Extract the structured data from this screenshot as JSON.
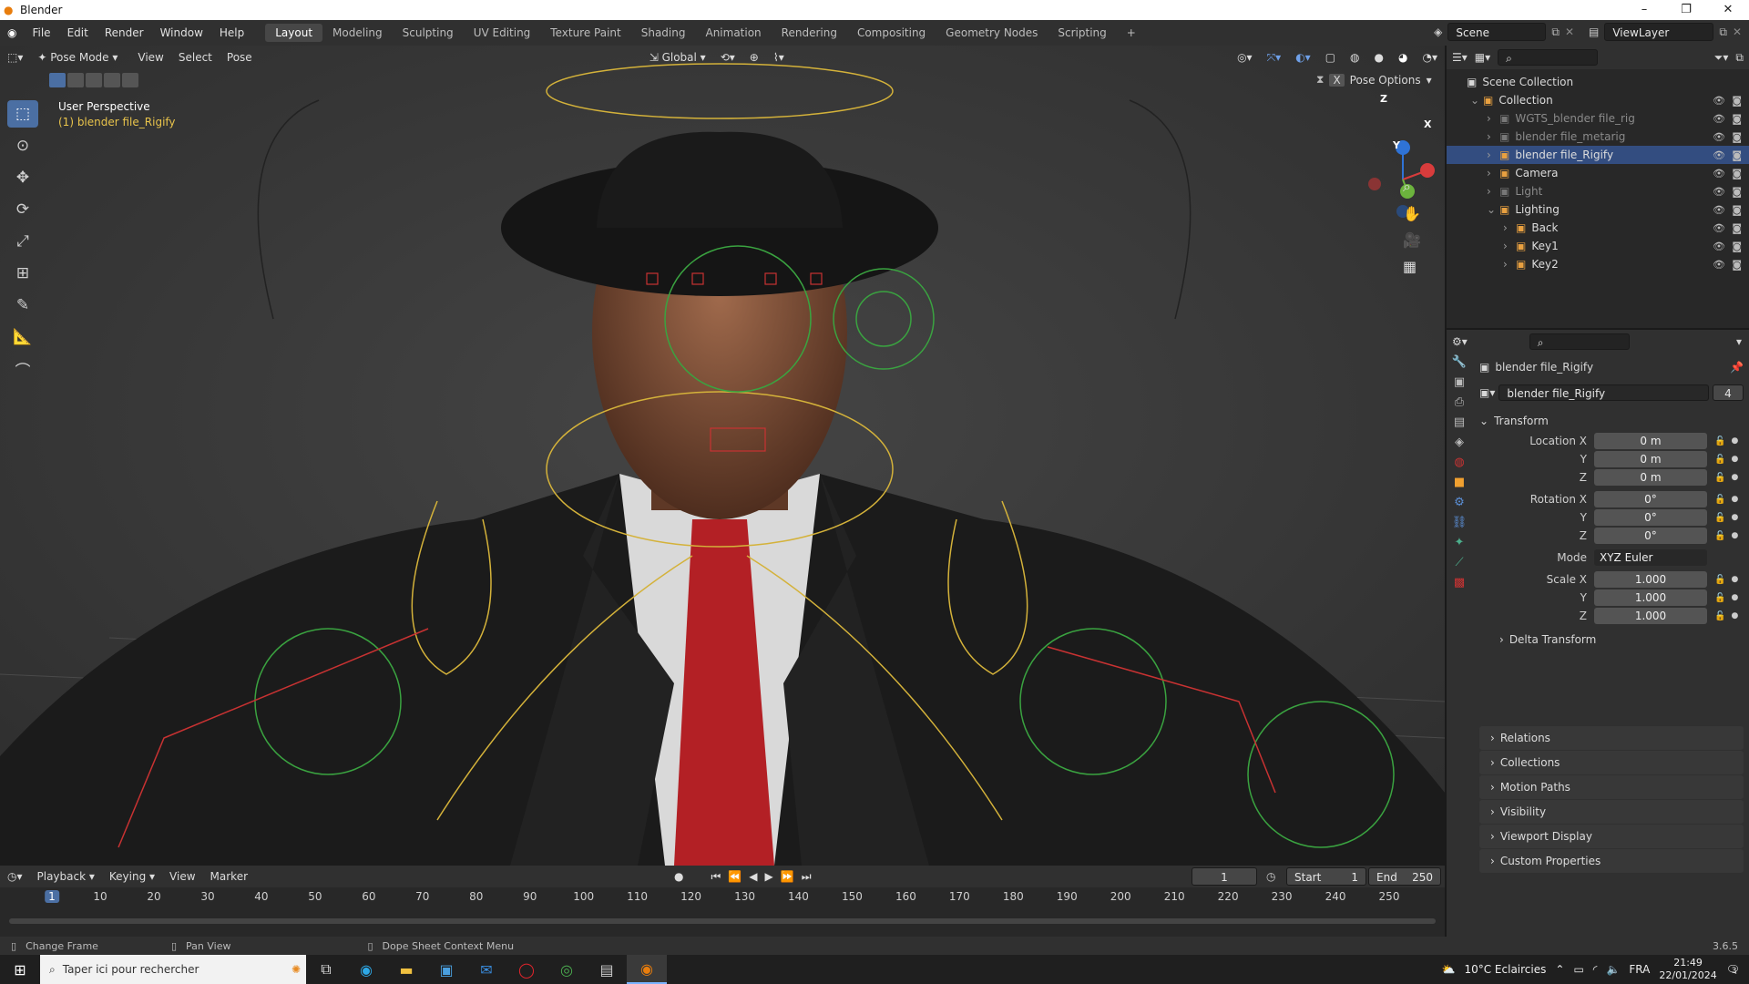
{
  "window": {
    "title": "Blender",
    "controls": [
      "–",
      "❐",
      "✕"
    ]
  },
  "menu": [
    "File",
    "Edit",
    "Render",
    "Window",
    "Help"
  ],
  "workspaces": [
    {
      "label": "Layout",
      "active": true
    },
    {
      "label": "Modeling"
    },
    {
      "label": "Sculpting"
    },
    {
      "label": "UV Editing"
    },
    {
      "label": "Texture Paint"
    },
    {
      "label": "Shading"
    },
    {
      "label": "Animation"
    },
    {
      "label": "Rendering"
    },
    {
      "label": "Compositing"
    },
    {
      "label": "Geometry Nodes"
    },
    {
      "label": "Scripting"
    }
  ],
  "scene": {
    "name": "Scene",
    "view_layer": "ViewLayer"
  },
  "viewport": {
    "mode": "Pose Mode",
    "menus": [
      "View",
      "Select",
      "Pose"
    ],
    "orientation": "Global",
    "pose_options": "Pose Options",
    "overlay_title": "User Perspective",
    "overlay_object": "(1) blender file_Rigify",
    "gizmo": {
      "x": "X",
      "y": "Y",
      "z": "Z"
    }
  },
  "tools": [
    "select-box",
    "cursor",
    "move",
    "rotate",
    "scale",
    "transform",
    "annotate",
    "measure",
    "bone-roll"
  ],
  "timeline": {
    "menus": [
      "Playback",
      "Keying",
      "View",
      "Marker"
    ],
    "current_frame": "1",
    "start_label": "Start",
    "start": "1",
    "end_label": "End",
    "end": "250",
    "ticks": [
      "1",
      "10",
      "20",
      "30",
      "40",
      "50",
      "60",
      "70",
      "80",
      "90",
      "100",
      "110",
      "120",
      "130",
      "140",
      "150",
      "160",
      "170",
      "180",
      "190",
      "200",
      "210",
      "220",
      "230",
      "240",
      "250"
    ]
  },
  "status": {
    "left": "Change Frame",
    "middle": "Pan View",
    "right": "Dope Sheet Context Menu",
    "version": "3.6.5"
  },
  "outliner": {
    "root": "Scene Collection",
    "items": [
      {
        "label": "Collection",
        "depth": 1,
        "expanded": true
      },
      {
        "label": "WGTS_blender file_rig",
        "depth": 2,
        "dim": true
      },
      {
        "label": "blender file_metarig",
        "depth": 2,
        "dim": true
      },
      {
        "label": "blender file_Rigify",
        "depth": 2,
        "selected": true
      },
      {
        "label": "Camera",
        "depth": 2
      },
      {
        "label": "Light",
        "depth": 2,
        "dim": true
      },
      {
        "label": "Lighting",
        "depth": 2,
        "expanded": true
      },
      {
        "label": "Back",
        "depth": 3
      },
      {
        "label": "Key1",
        "depth": 3
      },
      {
        "label": "Key2",
        "depth": 3
      }
    ]
  },
  "properties": {
    "object_name": "blender file_Rigify",
    "datablock": "blender file_Rigify",
    "users": "4",
    "transform_label": "Transform",
    "rows": [
      {
        "label": "Location X",
        "value": "0 m"
      },
      {
        "label": "Y",
        "value": "0 m"
      },
      {
        "label": "Z",
        "value": "0 m"
      },
      {
        "label": "Rotation X",
        "value": "0°"
      },
      {
        "label": "Y",
        "value": "0°"
      },
      {
        "label": "Z",
        "value": "0°"
      },
      {
        "label": "Mode",
        "value": "XYZ Euler"
      },
      {
        "label": "Scale X",
        "value": "1.000"
      },
      {
        "label": "Y",
        "value": "1.000"
      },
      {
        "label": "Z",
        "value": "1.000"
      }
    ],
    "delta": "Delta Transform",
    "panels": [
      "Relations",
      "Collections",
      "Motion Paths",
      "Visibility",
      "Viewport Display",
      "Custom Properties"
    ]
  },
  "taskbar": {
    "search_placeholder": "Taper ici pour rechercher",
    "weather": "10°C  Eclaircies",
    "lang": "FRA",
    "time": "21:49",
    "date": "22/01/2024",
    "notif": "3"
  },
  "colors": {
    "accent": "#4b6fa3",
    "selected_row": "#334d80",
    "bone_yellow": "#d4b23a",
    "bone_green": "#3aa340",
    "bone_red": "#c83232"
  }
}
